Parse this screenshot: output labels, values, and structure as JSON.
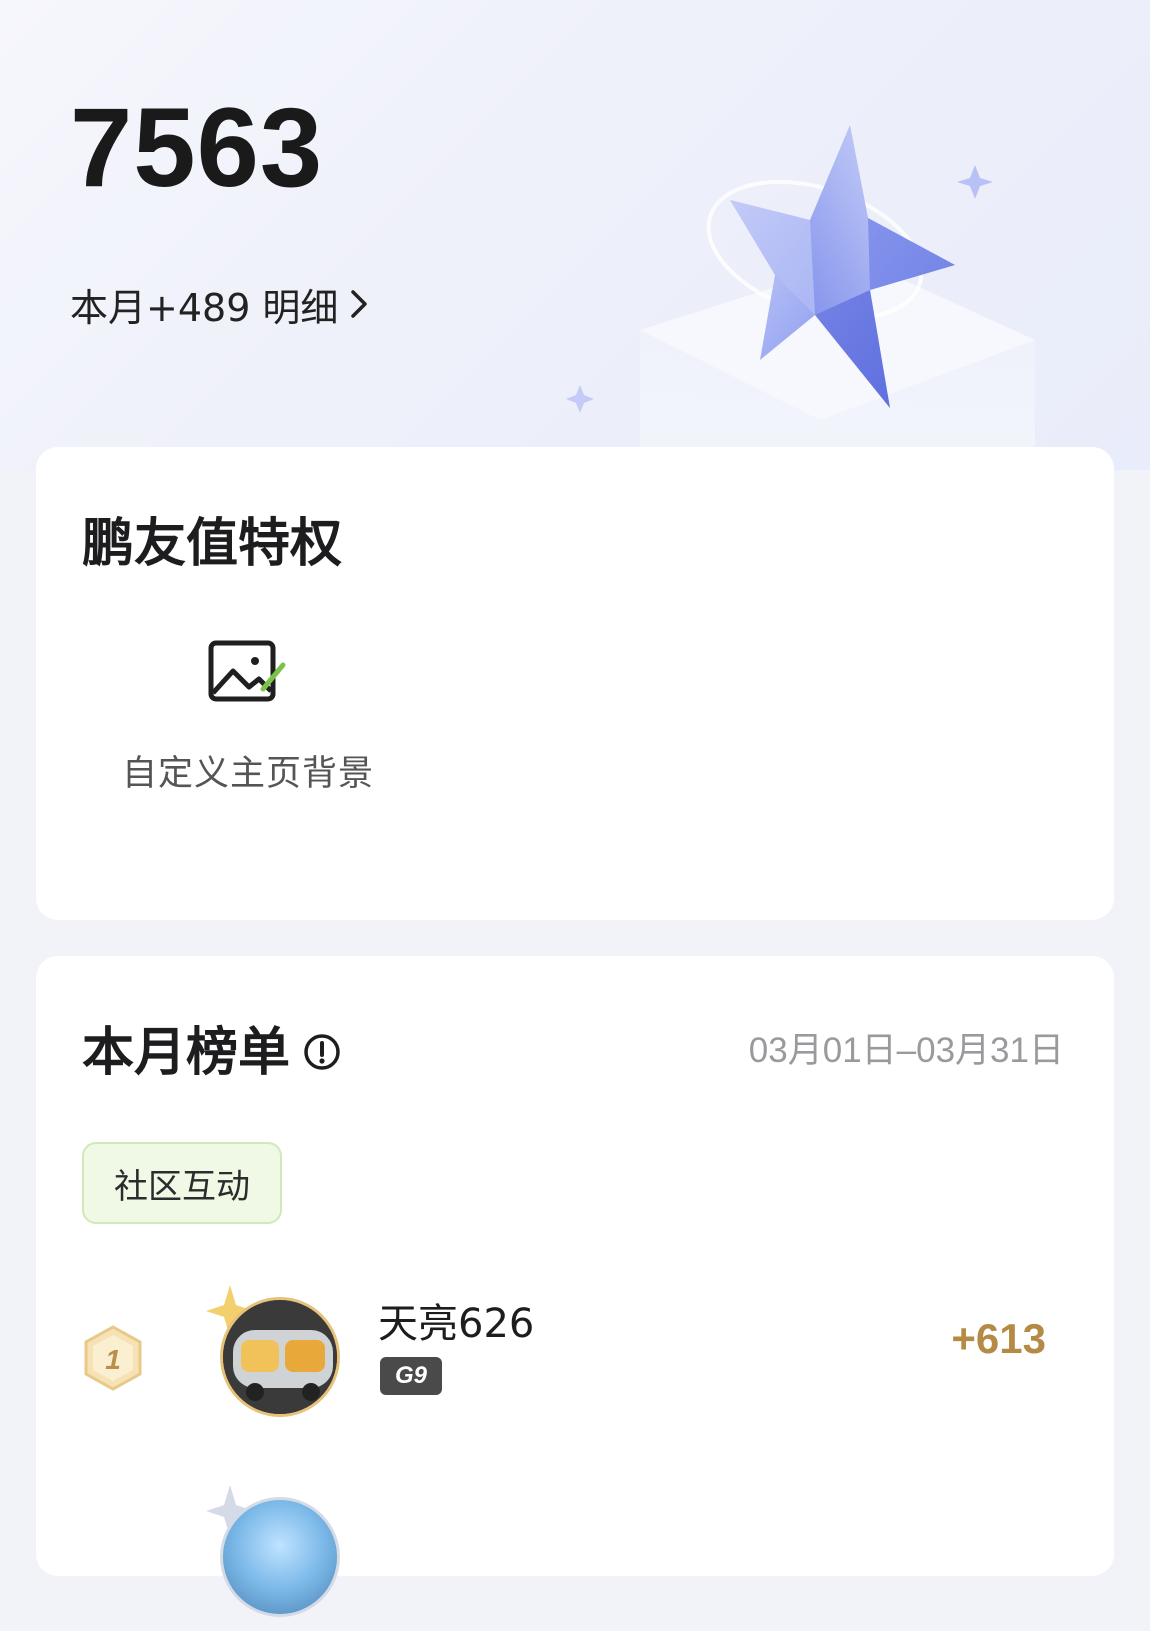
{
  "header": {
    "points": "7563",
    "month_change": "本月+489",
    "detail_label": "明细"
  },
  "privileges_card": {
    "title": "鹏友值特权",
    "items": [
      {
        "label": "自定义主页背景",
        "icon": "image-edit-icon"
      }
    ]
  },
  "ranking_card": {
    "title": "本月榜单",
    "date_range": "03月01日–03月31日",
    "tabs": [
      {
        "label": "社区互动",
        "active": true
      }
    ],
    "rows": [
      {
        "rank": "1",
        "name": "天亮626",
        "badge": "G9",
        "score": "+613"
      }
    ]
  },
  "colors": {
    "accent_green_bg": "#eff9e6",
    "accent_green_border": "#cfe9b9",
    "score_gold": "#b48a45",
    "icon_green": "#7cc24a"
  }
}
